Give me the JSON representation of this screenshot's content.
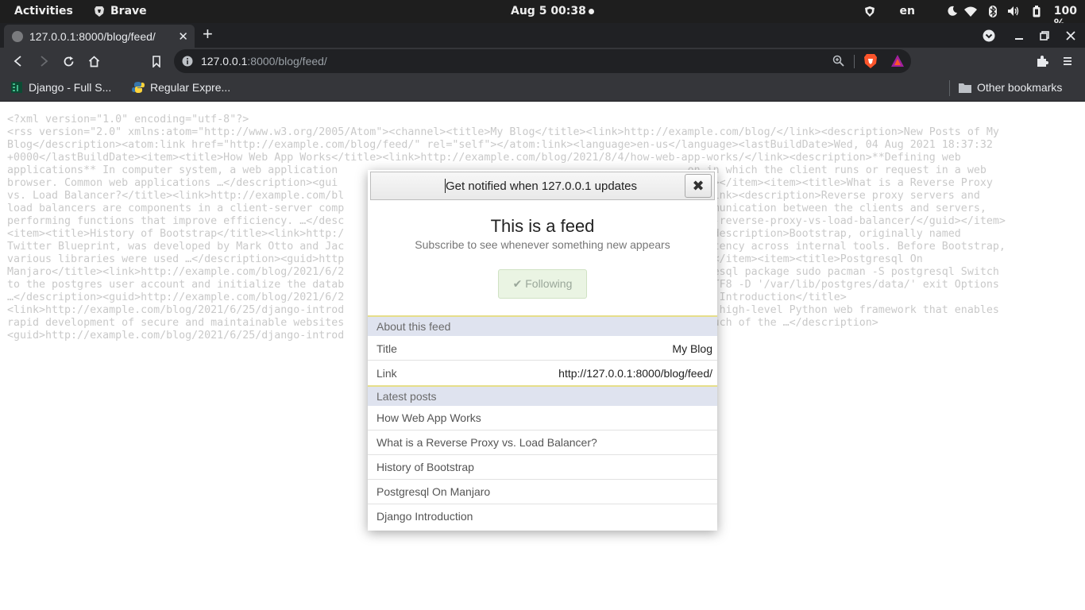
{
  "topbar": {
    "activities": "Activities",
    "app_name": "Brave",
    "clock": "Aug 5  00:38",
    "lang": "en",
    "battery": "100 %"
  },
  "tab": {
    "title": "127.0.0.1:8000/blog/feed/"
  },
  "omnibox": {
    "url_host": "127.0.0.1",
    "url_rest": ":8000/blog/feed/"
  },
  "bookmarks": {
    "items": [
      {
        "label": "Django - Full S...",
        "icon": "django-icon"
      },
      {
        "label": "Regular Expre...",
        "icon": "python-icon"
      }
    ],
    "other": "Other bookmarks"
  },
  "page": {
    "raw_lines": [
      "<?xml version=\"1.0\" encoding=\"utf-8\"?>",
      "<rss version=\"2.0\" xmlns:atom=\"http://www.w3.org/2005/Atom\"><channel><title>My Blog</title><link>http://example.com/blog/</link><description>New Posts of My",
      "Blog</description><atom:link href=\"http://example.com/blog/feed/\" rel=\"self\"></atom:link><language>en-us</language><lastBuildDate>Wed, 04 Aug 2021 18:37:32",
      "+0000</lastBuildDate><item><title>How Web App Works</title><link>http://example.com/blog/2021/8/4/how-web-app-works/</link><description>**Defining web",
      "applications** In computer system, a web application                                                       on in which the client runs or request in a web",
      "browser. Common web applications …</description><gui                                                     </guid></item><item><title>What is a Reverse Proxy",
      "vs. Load Balancer?</title><link>http://example.com/bl                                                    er/</link><description>Reverse proxy servers and",
      "load balancers are components in a client-server comp                                                    he communication between the clients and servers,",
      "performing functions that improve efficiency. …</desc                                                    t-is-a-reverse-proxy-vs-load-balancer/</guid></item>",
      "<item><title>History of Bootstrap</title><link>http:/                                                    link><description>Bootstrap, originally named",
      "Twitter Blueprint, was developed by Mark Otto and Jac                                                    consistency across internal tools. Before Bootstrap,",
      "various libraries were used …</description><guid>http                                                    /guid></item><item><title>Postgresql On",
      "Manjaro</title><link>http://example.com/blog/2021/6/2                                                    postgresql package sudo pacman -S postgresql Switch",
      "to the postgres user account and initialize the datab                                                    G -E UTF8 -D '/var/lib/postgres/data/' exit Options",
      "…</description><guid>http://example.com/blog/2021/6/2                                                    Django Introduction</title>",
      "<link>http://example.com/blog/2021/6/25/django-introd                                                    o is a high-level Python web framework that enables",
      "rapid development of secure and maintainable websites                                                    e of much of the …</description>",
      "<guid>http://example.com/blog/2021/6/25/django-introd"
    ]
  },
  "popup": {
    "header": "Get notified when 127.0.0.1 updates",
    "close_symbol": "✖",
    "title": "This is a feed",
    "subtitle": "Subscribe to see whenever something new appears",
    "follow_label": "✔ Following",
    "about_heading": "About this feed",
    "about_rows": [
      {
        "key": "Title",
        "value": "My Blog"
      },
      {
        "key": "Link",
        "value": "http://127.0.0.1:8000/blog/feed/"
      }
    ],
    "latest_heading": "Latest posts",
    "posts": [
      "How Web App Works",
      "What is a Reverse Proxy vs. Load Balancer?",
      "History of Bootstrap",
      "Postgresql On Manjaro",
      "Django Introduction"
    ]
  }
}
